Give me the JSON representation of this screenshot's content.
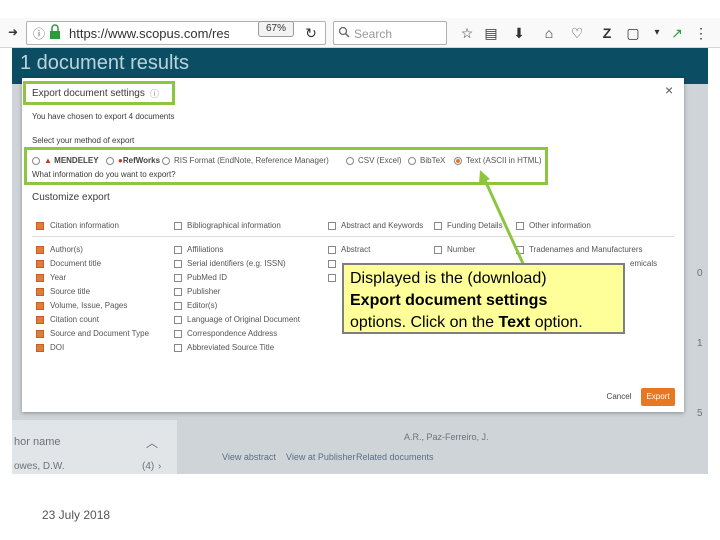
{
  "browser": {
    "url": "https://www.scopus.com/results/r",
    "zoom": "67%",
    "search_placeholder": "Search",
    "info_icon": "ⓘ",
    "lock_icon": "🔒",
    "reload_icon": "↻",
    "search_icon": "🔍"
  },
  "page": {
    "results_title": "1 document results",
    "author_name_label": "hor name",
    "author_row": "owes, D.W.",
    "author_count": "(4)",
    "author_names": "A.R., Paz-Ferreiro, J.",
    "view_abstract": "View abstract",
    "view_at_publisher": "View at Publisher",
    "related_documents": "Related documents",
    "numbers": [
      "0",
      "1",
      "5"
    ]
  },
  "modal": {
    "title": "Export document settings",
    "info_icon": "ⓘ",
    "close_icon": "×",
    "chosen_text": "You have chosen to export 4 documents",
    "select_method_label": "Select your method of export",
    "methods": [
      {
        "label": "MENDELEY",
        "selected": false
      },
      {
        "label": "RefWorks",
        "selected": false
      },
      {
        "label": "RIS Format (EndNote, Reference Manager)",
        "selected": false
      },
      {
        "label": "CSV (Excel)",
        "selected": false
      },
      {
        "label": "BibTeX",
        "selected": false
      },
      {
        "label": "Text (ASCII in HTML)",
        "selected": true
      }
    ],
    "what_info_label": "What information do you want to export?",
    "customize_label": "Customize export",
    "groups": [
      {
        "label": "Citation information",
        "checked": true
      },
      {
        "label": "Bibliographical information",
        "checked": false
      },
      {
        "label": "Abstract and Keywords",
        "checked": false
      },
      {
        "label": "Funding Details",
        "checked": false
      },
      {
        "label": "Other information",
        "checked": false
      }
    ],
    "citation_items": [
      "Author(s)",
      "Document title",
      "Year",
      "Source title",
      "Volume, Issue, Pages",
      "Citation count",
      "Source and Document Type",
      "DOI"
    ],
    "biblio_items": [
      "Affiliations",
      "Serial identifiers (e.g. ISSN)",
      "PubMed ID",
      "Publisher",
      "Editor(s)",
      "Language of Original Document",
      "Correspondence Address",
      "Abbreviated Source Title"
    ],
    "abstract_items": [
      "Abstract"
    ],
    "funding_items": [
      "Number"
    ],
    "other_items": [
      "Tradenames and Manufacturers"
    ],
    "other_item_tail": "emicals",
    "cancel_label": "Cancel",
    "export_label": "Export"
  },
  "callout": {
    "line1": "Displayed is the (download)",
    "line2": "Export document settings",
    "line3_pre": "options.  Click on the ",
    "line3_bold": "Text",
    "line3_post": " option."
  },
  "footer": {
    "date": "23 July 2018"
  },
  "colors": {
    "highlight": "#8cc63f",
    "accent": "#e87722",
    "header": "#0b4e64",
    "callout_bg": "#ffff99"
  }
}
